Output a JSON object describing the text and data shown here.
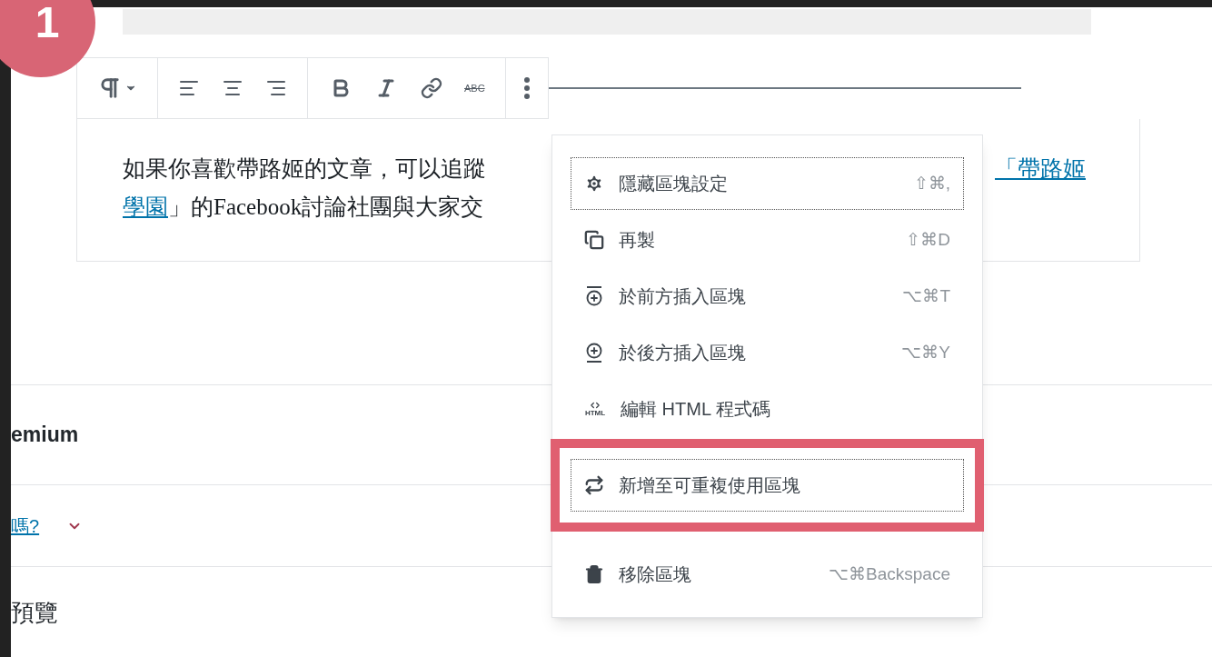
{
  "step_badge": "1",
  "toolbar": {
    "strike_label": "ABC"
  },
  "paragraph": {
    "text_before": "如果你喜歡帶路姬的文章，可以追蹤",
    "link_end": "「帶路姬",
    "link_start": "學園",
    "text_after": "」的Facebook討論社團與大家交"
  },
  "menu": {
    "groups": [
      [
        {
          "kind": "settings",
          "label": "隱藏區塊設定",
          "shortcut": "⇧⌘,",
          "selected": true,
          "highlighted": false
        },
        {
          "kind": "duplicate",
          "label": "再製",
          "shortcut": "⇧⌘D",
          "selected": false,
          "highlighted": false
        },
        {
          "kind": "insert_before",
          "label": "於前方插入區塊",
          "shortcut": "⌥⌘T",
          "selected": false,
          "highlighted": false
        },
        {
          "kind": "insert_after",
          "label": "於後方插入區塊",
          "shortcut": "⌥⌘Y",
          "selected": false,
          "highlighted": false
        },
        {
          "kind": "html",
          "label": "編輯 HTML 程式碼",
          "icon_text": "HTML",
          "selected": false,
          "highlighted": false
        },
        {
          "kind": "reusable",
          "label": "新增至可重複使用區塊",
          "selected": true,
          "highlighted": true
        }
      ],
      [
        {
          "kind": "remove",
          "label": "移除區塊",
          "shortcut": "⌥⌘Backspace",
          "selected": false,
          "highlighted": false
        }
      ]
    ]
  },
  "sections": [
    {
      "kind": "heading",
      "text": "emium"
    },
    {
      "kind": "link",
      "text": "嗎?"
    },
    {
      "kind": "heading_large",
      "text": "預覽"
    }
  ]
}
